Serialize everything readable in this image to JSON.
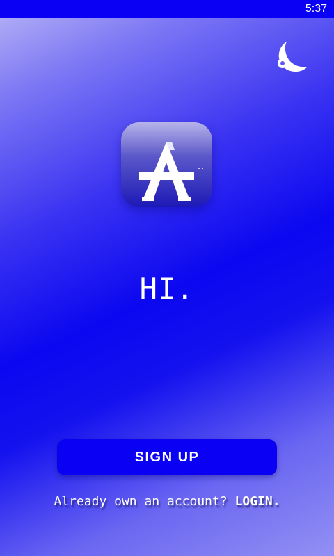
{
  "status_bar": {
    "time": "5:37"
  },
  "icons": {
    "theme_toggle": "moon-icon",
    "app_logo": "app-logo-a"
  },
  "welcome": {
    "greeting": "HI."
  },
  "actions": {
    "signup_label": "SIGN UP",
    "login_prompt": "Already own an account?",
    "login_label": "LOGIN."
  },
  "colors": {
    "accent": "#0a00f4",
    "text": "#ffffff"
  }
}
